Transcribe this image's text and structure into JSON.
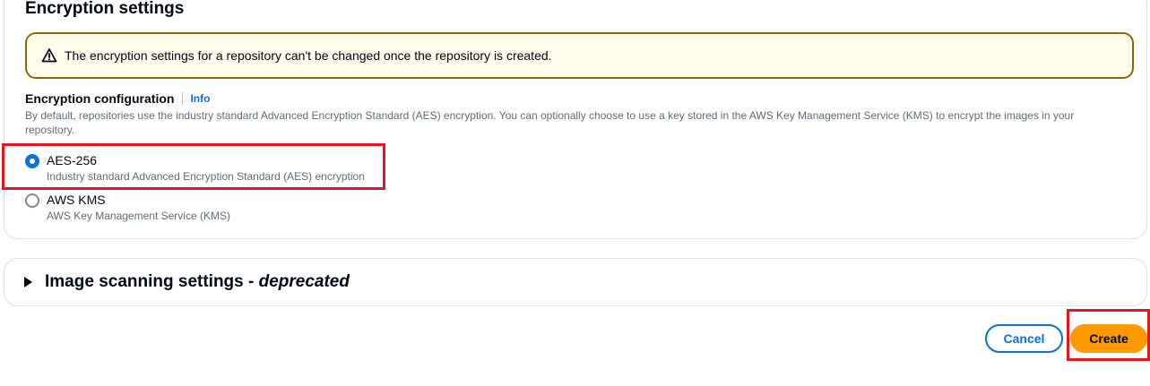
{
  "encryption_panel": {
    "title": "Encryption settings",
    "alert": {
      "icon": "warning-icon",
      "text": "The encryption settings for a repository can't be changed once the repository is created."
    },
    "field": {
      "label": "Encryption configuration",
      "info_link": "Info",
      "description": "By default, repositories use the industry standard Advanced Encryption Standard (AES) encryption. You can optionally choose to use a key stored in the AWS Key Management Service (KMS) to encrypt the images in your repository."
    },
    "options": [
      {
        "label": "AES-256",
        "description": "Industry standard Advanced Encryption Standard (AES) encryption",
        "selected": true
      },
      {
        "label": "AWS KMS",
        "description": "AWS Key Management Service (KMS)",
        "selected": false
      }
    ]
  },
  "image_scanning_section": {
    "title_main": "Image scanning settings - ",
    "title_emphasis": "deprecated",
    "expanded": false
  },
  "actions": {
    "cancel_label": "Cancel",
    "create_label": "Create"
  },
  "colors": {
    "primary": "#0972d3",
    "create_button": "#ff9900",
    "alert_border": "#8d6605",
    "highlight": "#e0181f"
  }
}
